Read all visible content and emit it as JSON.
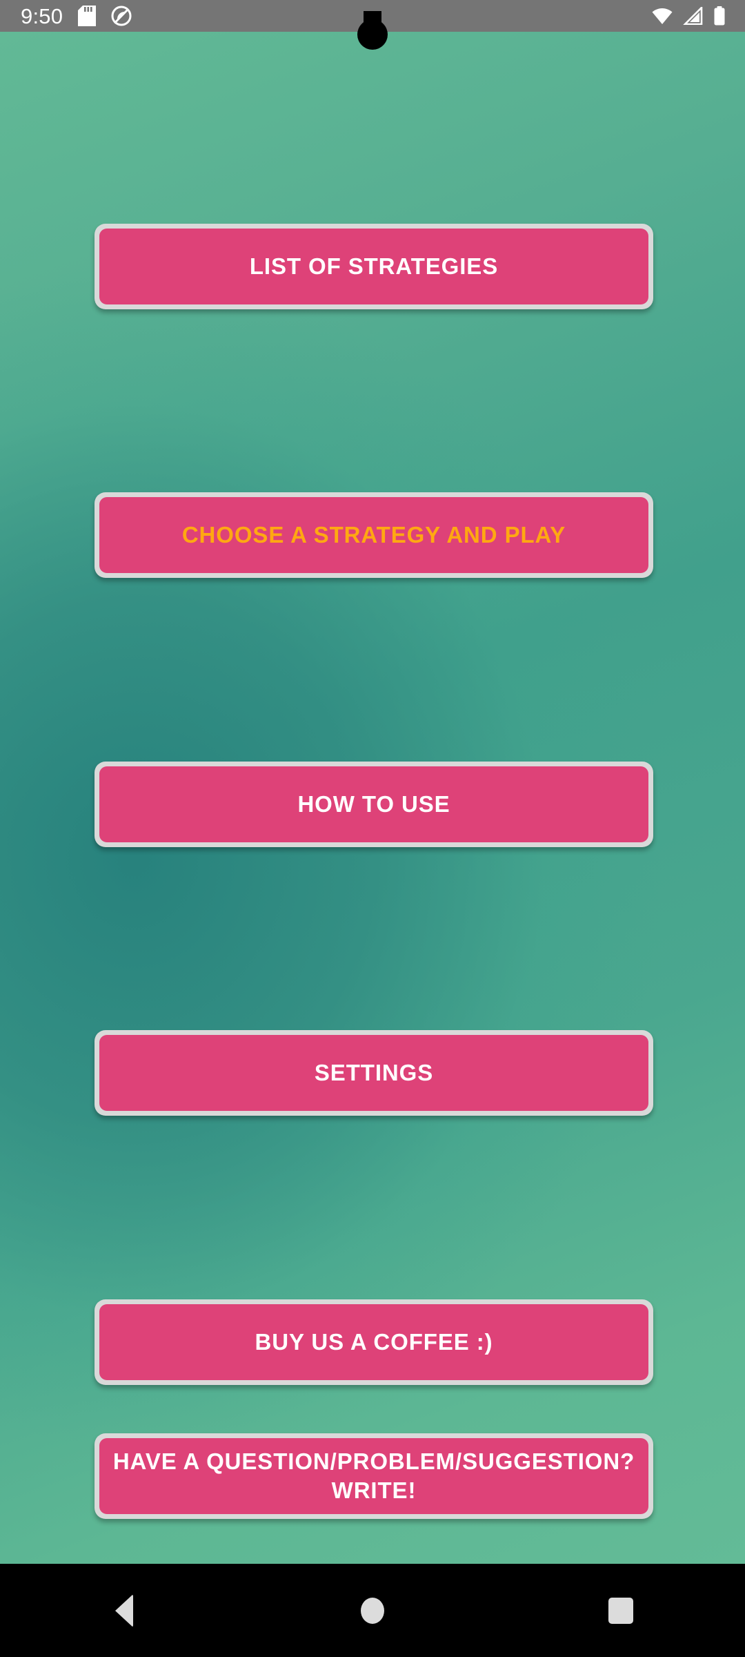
{
  "status_bar": {
    "time": "9:50",
    "left_icons": [
      "sd-card-icon",
      "data-saver-icon"
    ],
    "right_icons": [
      "wifi-icon",
      "cellular-signal-icon",
      "battery-icon"
    ],
    "background_color": "#757575"
  },
  "theme": {
    "button_fill": "#de4278",
    "button_border": "#d9d9d9",
    "accent_text": "#ffa812",
    "label_text": "#ffffff",
    "background_green": "#5eb793",
    "background_teal": "#348d83"
  },
  "menu": {
    "buttons": [
      {
        "label": "LIST OF STRATEGIES",
        "style": "default"
      },
      {
        "label": "CHOOSE A STRATEGY AND PLAY",
        "style": "accent"
      },
      {
        "label": "HOW TO USE",
        "style": "default"
      },
      {
        "label": "SETTINGS",
        "style": "default"
      },
      {
        "label": "BUY US A COFFEE :)",
        "style": "default"
      },
      {
        "label": "HAVE A QUESTION/PROBLEM/SUGGESTION? WRITE!",
        "style": "default"
      }
    ]
  },
  "nav_bar": {
    "back_label": "Back",
    "home_label": "Home",
    "recents_label": "Recents"
  }
}
